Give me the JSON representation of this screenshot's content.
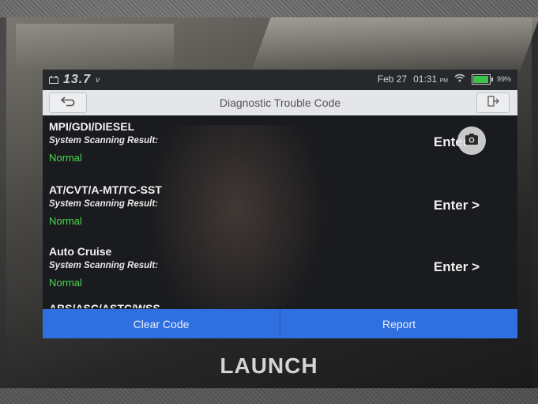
{
  "status_bar": {
    "voltage": "13.7",
    "voltage_unit": "v",
    "date": "Feb 27",
    "time": "01:31",
    "ampm": "PM",
    "battery_percent": "99%",
    "battery_level": 0.99,
    "icons": [
      "car-battery-icon",
      "wifi-icon",
      "battery-icon"
    ]
  },
  "header": {
    "title": "Diagnostic Trouble Code",
    "back_icon": "back-arrow-icon",
    "exit_icon": "exit-icon"
  },
  "systems": [
    {
      "name": "MPI/GDI/DIESEL",
      "label": "System Scanning Result:",
      "status": "Normal",
      "action": "Enter >"
    },
    {
      "name": "AT/CVT/A-MT/TC-SST",
      "label": "System Scanning Result:",
      "status": "Normal",
      "action": "Enter >"
    },
    {
      "name": "Auto Cruise",
      "label": "System Scanning Result:",
      "status": "Normal",
      "action": "Enter >"
    },
    {
      "name": "ABS/ASC/ASTC/WSS",
      "label": "",
      "status": "",
      "action": ""
    }
  ],
  "footer": {
    "clear_code": "Clear Code",
    "report": "Report"
  },
  "camera_icon": "camera-icon",
  "brand": "LAUNCH",
  "colors": {
    "accent": "#2f6fe0",
    "status_normal": "#49d84f",
    "header_bg": "#e4e6e9",
    "screen_bg": "#1a1b1e"
  }
}
